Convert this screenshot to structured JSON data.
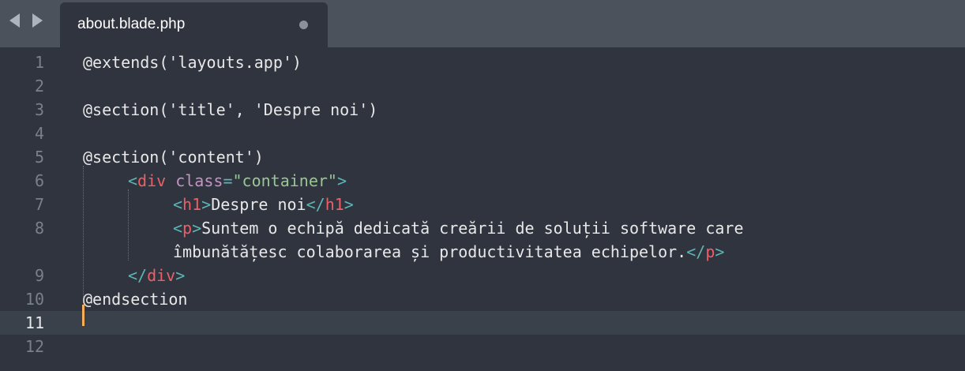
{
  "tab": {
    "title": "about.blade.php",
    "unsaved": true
  },
  "nav": {
    "back_icon": "triangle-left",
    "forward_icon": "triangle-right"
  },
  "colors": {
    "background": "#2f343e",
    "tabbar": "#4b525c",
    "tag": "#ec5f67",
    "attribute": "#c594c5",
    "string": "#99c794",
    "punctuation": "#5fb4b4",
    "caret": "#f9ae58"
  },
  "editor": {
    "current_line": 11,
    "lines": [
      {
        "number": "1",
        "text": "@extends('layouts.app')"
      },
      {
        "number": "2",
        "text": ""
      },
      {
        "number": "3",
        "text": "@section('title', 'Despre noi')"
      },
      {
        "number": "4",
        "text": ""
      },
      {
        "number": "5",
        "text": "@section('content')"
      },
      {
        "number": "6",
        "tokens": [
          "<",
          "div",
          " ",
          "class",
          "=",
          "\"container\"",
          ">"
        ]
      },
      {
        "number": "7",
        "tokens": [
          "<",
          "h1",
          ">",
          "Despre noi",
          "</",
          "h1",
          ">"
        ]
      },
      {
        "number": "8",
        "tokens": [
          "<",
          "p",
          ">",
          "Suntem o echipă dedicată creării de soluții software care"
        ]
      },
      {
        "number": "",
        "tokens": [
          "îmbunătățesc colaborarea și productivitatea echipelor.",
          "</",
          "p",
          ">"
        ]
      },
      {
        "number": "9",
        "tokens": [
          "</",
          "div",
          ">"
        ]
      },
      {
        "number": "10",
        "text": "@endsection"
      },
      {
        "number": "11",
        "text": ""
      },
      {
        "number": "12",
        "text": ""
      }
    ]
  }
}
